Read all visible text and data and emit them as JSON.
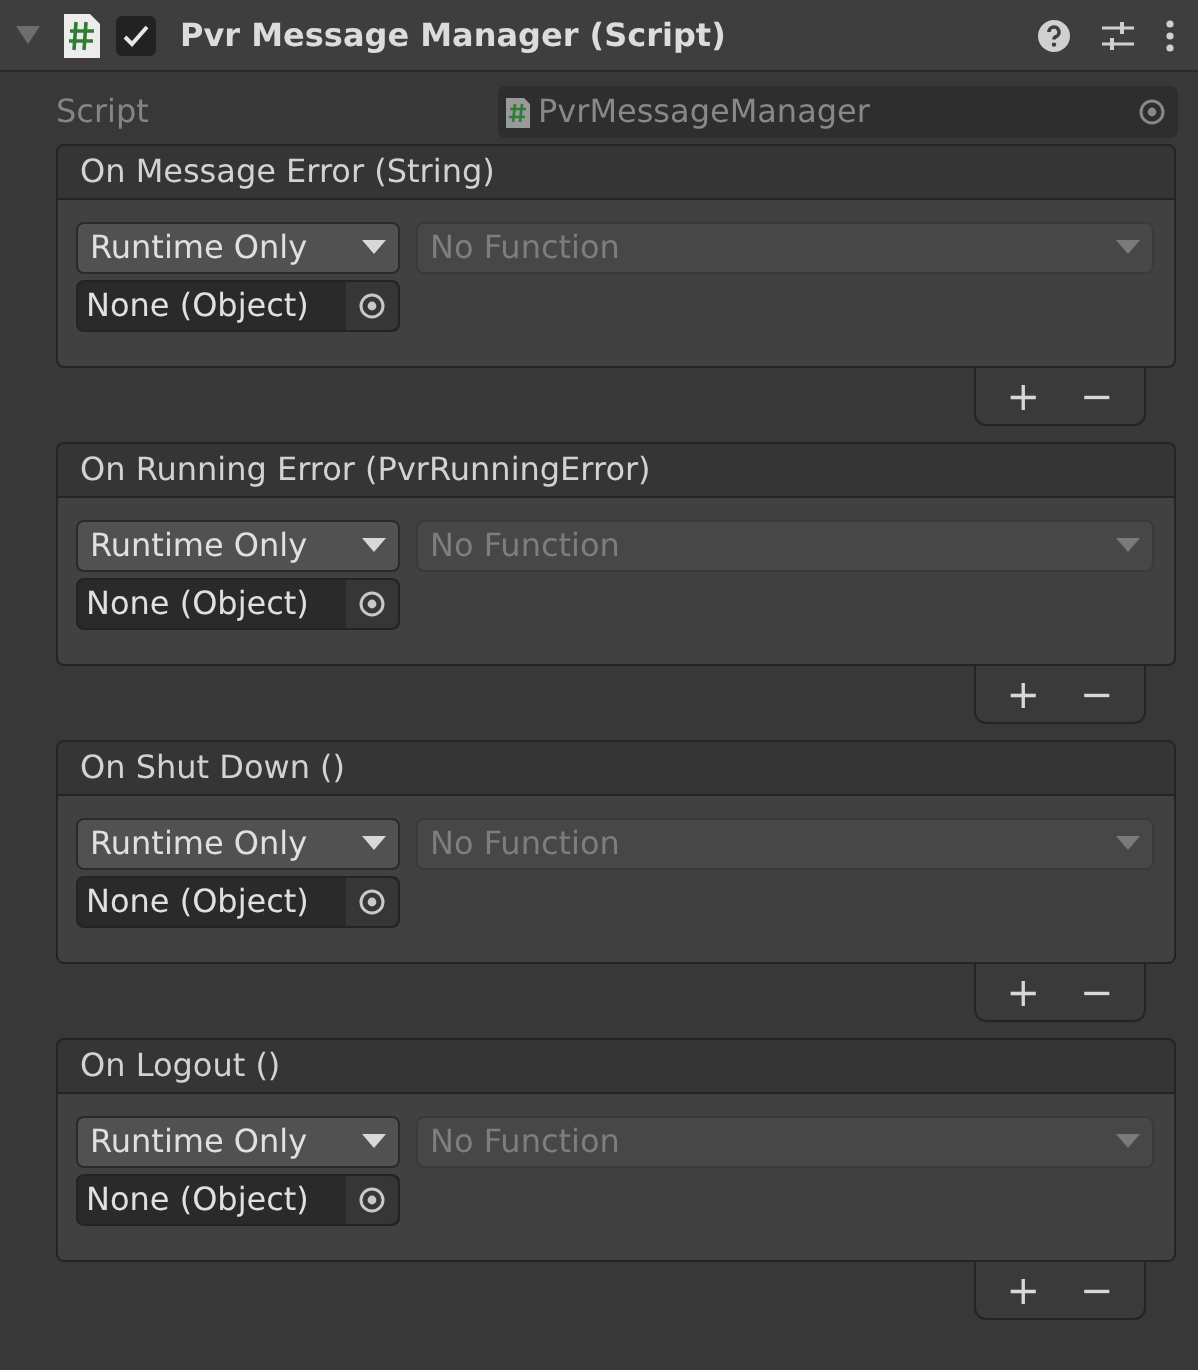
{
  "component": {
    "title": "Pvr Message Manager (Script)",
    "expanded": true,
    "enabled": true
  },
  "script_field": {
    "label": "Script",
    "value": "PvrMessageManager"
  },
  "events": [
    {
      "title": "On Message Error (String)",
      "mode": "Runtime Only",
      "function": "No Function",
      "function_disabled": true,
      "target": "None (Object)",
      "add": "+",
      "remove": "−"
    },
    {
      "title": "On Running Error (PvrRunningError)",
      "mode": "Runtime Only",
      "function": "No Function",
      "function_disabled": true,
      "target": "None (Object)",
      "add": "+",
      "remove": "−"
    },
    {
      "title": "On Shut Down ()",
      "mode": "Runtime Only",
      "function": "No Function",
      "function_disabled": true,
      "target": "None (Object)",
      "add": "+",
      "remove": "−"
    },
    {
      "title": "On Logout ()",
      "mode": "Runtime Only",
      "function": "No Function",
      "function_disabled": true,
      "target": "None (Object)",
      "add": "+",
      "remove": "−"
    }
  ]
}
